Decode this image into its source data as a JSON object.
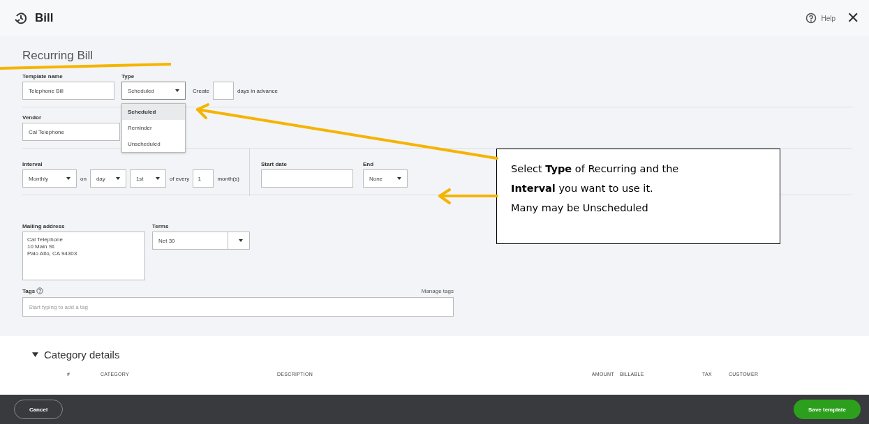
{
  "header": {
    "title": "Bill",
    "help": "Help",
    "close": "✕"
  },
  "form": {
    "title": "Recurring Bill",
    "template_name": {
      "label": "Template name",
      "value": "Telephone Bill"
    },
    "type": {
      "label": "Type",
      "value": "Scheduled",
      "expanded": true,
      "options": [
        {
          "label": "Scheduled",
          "selected": true
        },
        {
          "label": "Reminder",
          "selected": false
        },
        {
          "label": "Unscheduled",
          "selected": false
        }
      ]
    },
    "create": {
      "before": "Create",
      "after": "days in advance"
    },
    "vendor": {
      "label": "Vendor",
      "value": "Cal Telephone"
    },
    "interval": {
      "label": "Interval",
      "frequency": "Monthly",
      "on": "on",
      "unit": "day",
      "ordinal": "1st",
      "of_every": "of every",
      "count": "1",
      "period": "month(s)"
    },
    "start_date": {
      "label": "Start date"
    },
    "end": {
      "label": "End",
      "value": "None"
    },
    "mailing_address": {
      "label": "Mailing address",
      "lines": [
        "Cal Telephone",
        "10 Main St.",
        "Palo Alto, CA  94303"
      ]
    },
    "terms": {
      "label": "Terms",
      "value": "Net 30"
    },
    "tags": {
      "label": "Tags",
      "manage": "Manage tags",
      "placeholder": "Start typing to add a tag"
    }
  },
  "category_details": {
    "title": "Category details",
    "expanded": true,
    "columns": [
      "#",
      "CATEGORY",
      "DESCRIPTION",
      "AMOUNT",
      "BILLABLE",
      "TAX",
      "CUSTOMER"
    ]
  },
  "footer": {
    "cancel": "Cancel",
    "save": "Save template"
  },
  "callout": {
    "lines": [
      "Select **Type** of Recurring and the",
      "**Interval** you want to use it.",
      "Many may be Unscheduled"
    ]
  }
}
